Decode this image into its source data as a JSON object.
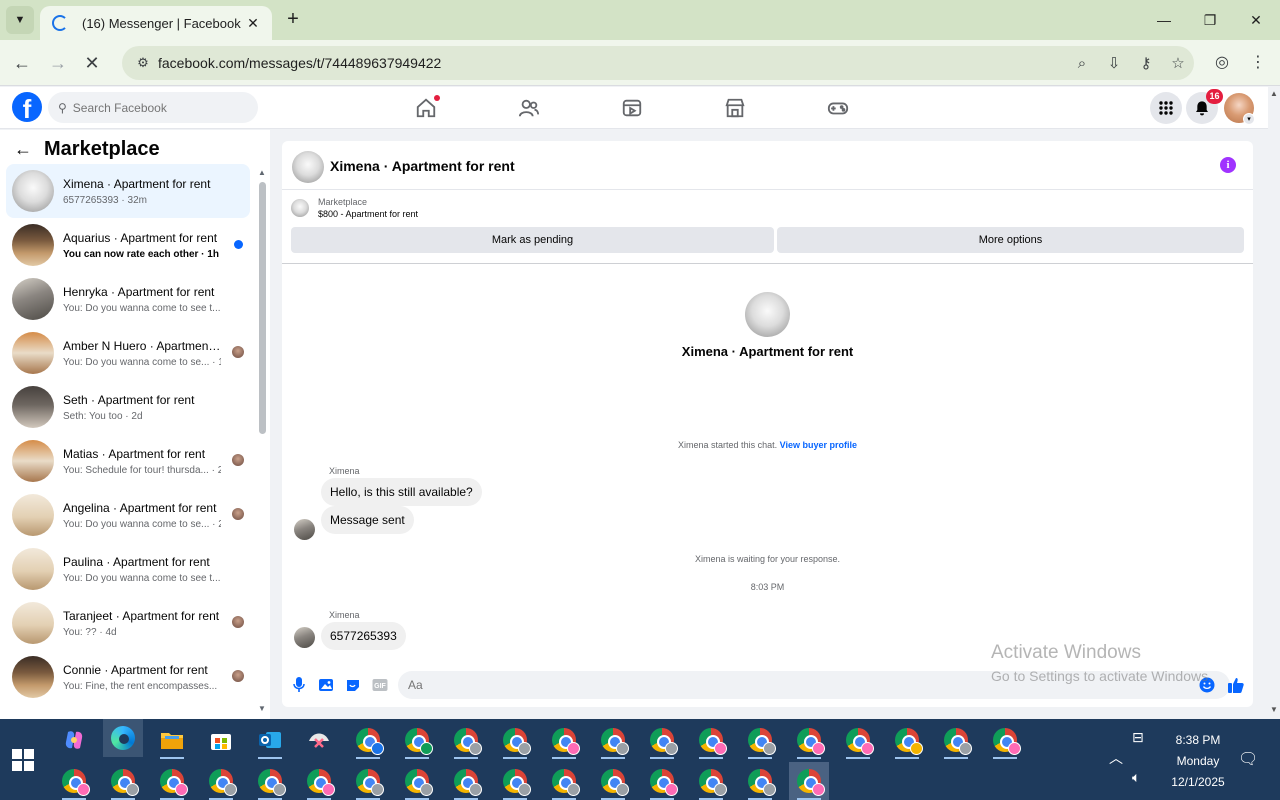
{
  "browser": {
    "tab_title": "(16) Messenger | Facebook",
    "url": "facebook.com/messages/t/744489637949422"
  },
  "facebook": {
    "search_placeholder": "Search Facebook",
    "notification_count": "16"
  },
  "left_panel": {
    "title": "Marketplace",
    "conversations": [
      {
        "name": "Ximena · Apartment for rent",
        "sub": "6577265393 · 32m",
        "active": true,
        "photo": "white"
      },
      {
        "name": "Aquarius · Apartment for rent",
        "sub": "You can now rate each other · 1h",
        "unread": true,
        "photo": "room"
      },
      {
        "name": "Henryka · Apartment for rent",
        "sub": "You: Do you wanna come to see t... · 1d",
        "photo": "kitchen"
      },
      {
        "name": "Amber N Huero · Apartment ...",
        "sub": "You: Do you wanna come to se... · 1d",
        "photo": "orange"
      },
      {
        "name": "Seth · Apartment for rent",
        "sub": "Seth: You too · 2d",
        "photo": "dark"
      },
      {
        "name": "Matias · Apartment for rent",
        "sub": "You: Schedule for tour! thursda... · 2d",
        "photo": "orange"
      },
      {
        "name": "Angelina · Apartment for rent",
        "sub": "You: Do you wanna come to se... · 2d",
        "photo": "cream"
      },
      {
        "name": "Paulina · Apartment for rent",
        "sub": "You: Do you wanna come to see t... · 2d",
        "photo": "cream"
      },
      {
        "name": "Taranjeet · Apartment for rent",
        "sub": "You: ?? · 4d",
        "photo": "cream"
      },
      {
        "name": "Connie · Apartment for rent",
        "sub": "You: Fine, the rent encompasses... · 4d",
        "photo": "room"
      }
    ]
  },
  "chat": {
    "header_name": "Ximena · Apartment for rent",
    "marketplace_label": "Marketplace",
    "listing": "$800 - Apartment for rent",
    "mark_pending": "Mark as pending",
    "more_options": "More options",
    "center_name": "Ximena · Apartment for rent",
    "started_text": "Ximena started this chat.",
    "view_profile": "View buyer profile",
    "sender": "Ximena",
    "msg1": "Hello, is this still available?",
    "msg2": "Message sent",
    "waiting": "Ximena is waiting for your response.",
    "timestamp": "8:03 PM",
    "msg3": "6577265393",
    "composer_placeholder": "Aa"
  },
  "watermark": {
    "line1": "Activate Windows",
    "line2": "Go to Settings to activate Windows."
  },
  "taskbar": {
    "time": "8:38 PM",
    "day": "Monday",
    "date": "12/1/2025"
  }
}
